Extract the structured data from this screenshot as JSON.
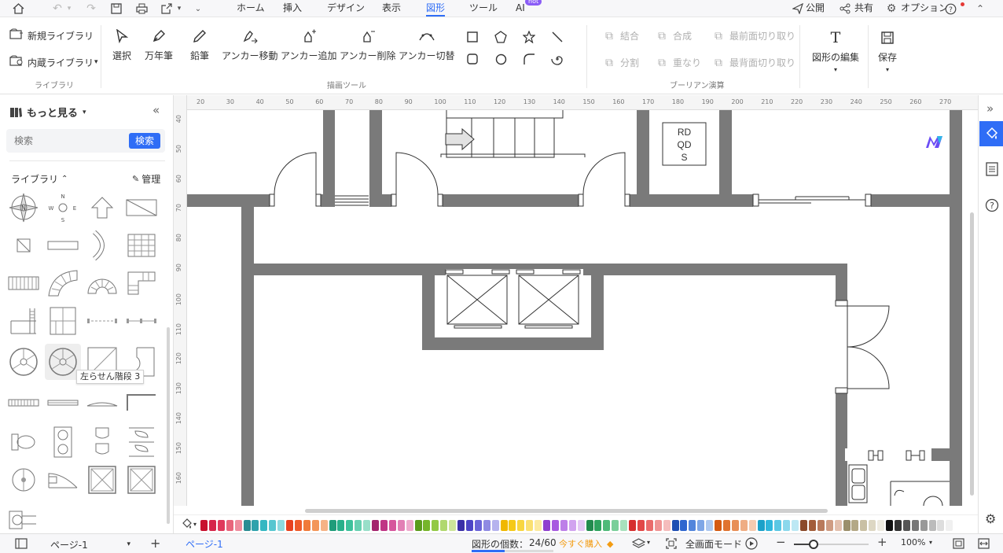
{
  "menubar": {
    "tabs": [
      {
        "label": "ホーム"
      },
      {
        "label": "挿入"
      },
      {
        "label": "デザイン"
      },
      {
        "label": "表示"
      },
      {
        "label": "図形"
      },
      {
        "label": "ツール"
      },
      {
        "label": "AI"
      }
    ],
    "ai_badge": "hot",
    "publish": "公開",
    "share": "共有",
    "options": "オプション"
  },
  "ribbon": {
    "library_group": {
      "new_library": "新規ライブラリ",
      "builtin_library": "内蔵ライブラリ",
      "caption": "ライブラリ"
    },
    "draw_tools": {
      "select": "選択",
      "pen": "万年筆",
      "pencil": "鉛筆",
      "anchor_move": "アンカー移動",
      "anchor_add": "アンカー追加",
      "anchor_delete": "アンカー削除",
      "anchor_switch": "アンカー切替",
      "caption": "描画ツール"
    },
    "boolean": {
      "union": "結合",
      "combine": "合成",
      "front_cut": "最前面切り取り",
      "divide": "分割",
      "overlap": "重なり",
      "back_cut": "最背面切り取り",
      "caption": "ブーリアン演算"
    },
    "edit_shape": "図形の編集",
    "save": "保存"
  },
  "left_panel": {
    "more": "もっと見る",
    "search_placeholder": "検索",
    "search_button": "検索",
    "library_label": "ライブラリ",
    "manage": "管理",
    "tooltip": "左らせん階段 3"
  },
  "ruler": {
    "h": [
      "20",
      "30",
      "40",
      "50",
      "60",
      "70",
      "80",
      "90",
      "100",
      "110",
      "120",
      "130",
      "140",
      "150",
      "160",
      "170",
      "180",
      "190",
      "200",
      "210",
      "220",
      "230",
      "240",
      "250",
      "260",
      "270"
    ],
    "v": [
      "40",
      "50",
      "60",
      "70",
      "80",
      "90",
      "100",
      "110",
      "120",
      "130",
      "140",
      "150",
      "160"
    ]
  },
  "canvas": {
    "room_label_lines": [
      "RD",
      "QD",
      "S"
    ]
  },
  "palette_colors": [
    "#c8102e",
    "#d6254a",
    "#e03a5c",
    "#e8657b",
    "#ef8d9e",
    "#2a8c93",
    "#2fa2ac",
    "#34b7c2",
    "#57c6d0",
    "#8dd9df",
    "#e8411f",
    "#ee5a2a",
    "#f07a3a",
    "#f39659",
    "#f6b386",
    "#1f9c7a",
    "#27b08a",
    "#3cc19b",
    "#67d0b1",
    "#98dfc9",
    "#a4256e",
    "#c03585",
    "#d6559c",
    "#e27fb5",
    "#eeaacd",
    "#5b9b1c",
    "#76b52a",
    "#93c946",
    "#b0d86e",
    "#cde59a",
    "#3b2fa8",
    "#4d44c6",
    "#6b64d8",
    "#8f8ae3",
    "#b6b3ee",
    "#f0b800",
    "#f5c918",
    "#f8d640",
    "#fae070",
    "#fcea9f",
    "#8f3fcf",
    "#a75ae0",
    "#bd7fe8",
    "#d1a3ef",
    "#e4c8f5",
    "#228b4e",
    "#2ea35e",
    "#4fba79",
    "#7acf9a",
    "#a8e1bd",
    "#d62f2f",
    "#e24848",
    "#ea6b6b",
    "#f09494",
    "#f5bcbc",
    "#1f4fb3",
    "#2e66cf",
    "#5285dc",
    "#7ea6e6",
    "#adc8f0",
    "#d45a12",
    "#e07330",
    "#e88f57",
    "#efad84",
    "#f5cbb0",
    "#1ba1c9",
    "#2fb6dc",
    "#5ac7e4",
    "#8bd8ec",
    "#bce8f4",
    "#8b4a2b",
    "#a35d3a",
    "#b97a5c",
    "#cf9c83",
    "#e3c0ae",
    "#9b8f6b",
    "#b3a886",
    "#c9c0a4",
    "#ddd7c3",
    "#eeebe1",
    "#111111",
    "#333333",
    "#555555",
    "#777777",
    "#999999",
    "#bbbbbb",
    "#dddddd",
    "#f0f0f0"
  ],
  "statusbar": {
    "page_selector": "ページ-1",
    "page_tab": "ページ-1",
    "shape_count": "図形の個数：",
    "shape_count_value": "24/60",
    "buy_now": "今すぐ購入",
    "fullscreen": "全画面モード",
    "zoom": "100%"
  }
}
